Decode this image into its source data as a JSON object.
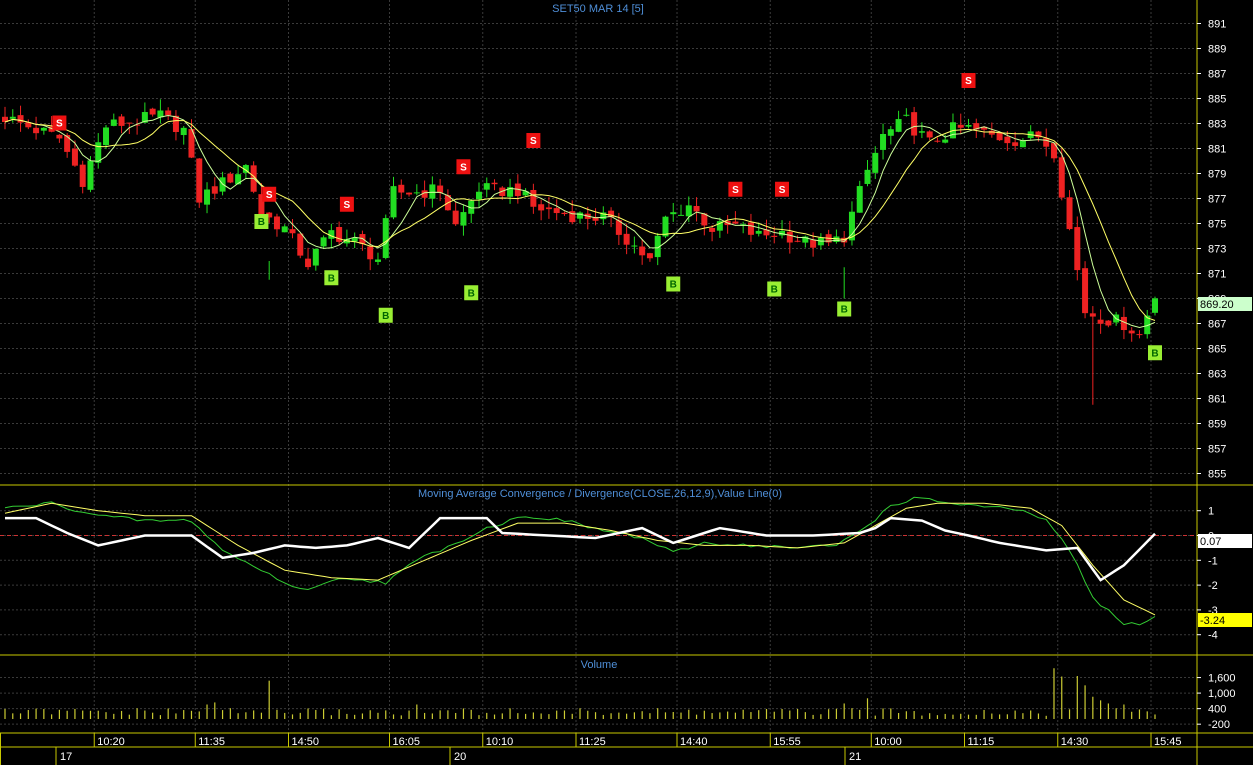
{
  "title": "SET50 MAR 14   [5]",
  "colors": {
    "background": "#000000",
    "grid": "#3a3a3a",
    "frame": "#c8c800",
    "up_candle": "#22dd22",
    "down_candle": "#ee2222",
    "ma_fast": "#ffff66",
    "ma_slow": "#ccff99",
    "macd": "#33cc33",
    "signal": "#ffff66",
    "value_line": "#ffffff",
    "zero_line": "#cc3333",
    "volume": "#cccc33",
    "title_text": "#4f8fd8",
    "buy_marker": "#99ee33",
    "sell_marker": "#ee1111",
    "axis_text": "#ffffff"
  },
  "price_panel": {
    "y_ticks": [
      "891",
      "889",
      "887",
      "885",
      "883",
      "881",
      "879",
      "877",
      "875",
      "873",
      "871",
      "869",
      "867",
      "865",
      "863",
      "861",
      "859",
      "857",
      "855"
    ],
    "ylim": [
      854,
      892
    ],
    "last_price": "869.20"
  },
  "macd_panel": {
    "title": "Moving Average Convergence / Divergence(CLOSE,26,12,9),Value Line(0)",
    "y_ticks": [
      "1",
      "0",
      "-1",
      "-2",
      "-3",
      "-4"
    ],
    "ylim": [
      -4.5,
      1.8
    ],
    "value_badge": "0.07",
    "macd_badge": "-3.24"
  },
  "volume_panel": {
    "title": "Volume",
    "y_ticks": [
      "1,600",
      "1,000",
      "400",
      "-200"
    ],
    "ylim": [
      -350,
      2050
    ]
  },
  "time_axis": {
    "times": [
      "10:20",
      "11:35",
      "14:50",
      "16:05",
      "10:10",
      "11:25",
      "14:40",
      "15:55",
      "10:00",
      "11:15",
      "14:30",
      "15:45"
    ],
    "days": [
      "17",
      "20",
      "21"
    ]
  },
  "signal_labels": {
    "buy": "B",
    "sell": "S"
  },
  "chart_data": {
    "type": "candlestick",
    "title": "SET50 MAR 14   [5]",
    "x_bars": 148,
    "time_ticks": [
      {
        "bar": 12,
        "label": "10:20"
      },
      {
        "bar": 25,
        "label": "11:35"
      },
      {
        "bar": 37,
        "label": "14:50"
      },
      {
        "bar": 50,
        "label": "16:05"
      },
      {
        "bar": 62,
        "label": "10:10"
      },
      {
        "bar": 74,
        "label": "11:25"
      },
      {
        "bar": 87,
        "label": "14:40"
      },
      {
        "bar": 99,
        "label": "15:55"
      },
      {
        "bar": 112,
        "label": "10:00"
      },
      {
        "bar": 124,
        "label": "11:15"
      },
      {
        "bar": 136,
        "label": "14:30"
      },
      {
        "bar": 148,
        "label": "15:45"
      }
    ],
    "day_ticks": [
      {
        "bar": 7,
        "label": "17"
      },
      {
        "bar": 58,
        "label": "20"
      },
      {
        "bar": 109,
        "label": "21"
      }
    ],
    "price_keypoints": [
      [
        0,
        883.5
      ],
      [
        4,
        882.5
      ],
      [
        7,
        881.8
      ],
      [
        10,
        878.5
      ],
      [
        13,
        882.8
      ],
      [
        17,
        883.2
      ],
      [
        20,
        883.6
      ],
      [
        23,
        882.5
      ],
      [
        25,
        877
      ],
      [
        28,
        878.2
      ],
      [
        31,
        879.6
      ],
      [
        33,
        875.8
      ],
      [
        36,
        874.6
      ],
      [
        39,
        871.8
      ],
      [
        42,
        874.3
      ],
      [
        45,
        873.5
      ],
      [
        48,
        872.2
      ],
      [
        50,
        877.5
      ],
      [
        53,
        877.5
      ],
      [
        56,
        877.7
      ],
      [
        58,
        874.8
      ],
      [
        61,
        877.8
      ],
      [
        63,
        877.6
      ],
      [
        66,
        877.7
      ],
      [
        68,
        876.3
      ],
      [
        71,
        875.9
      ],
      [
        74,
        875.6
      ],
      [
        77,
        875.5
      ],
      [
        80,
        873.8
      ],
      [
        83,
        872
      ],
      [
        85,
        875.4
      ],
      [
        88,
        876.5
      ],
      [
        91,
        874.6
      ],
      [
        94,
        874.8
      ],
      [
        97,
        874
      ],
      [
        100,
        874.3
      ],
      [
        103,
        873.5
      ],
      [
        106,
        873.3
      ],
      [
        108,
        874
      ],
      [
        111,
        879.2
      ],
      [
        113,
        882
      ],
      [
        116,
        883.2
      ],
      [
        119,
        881.4
      ],
      [
        122,
        882.5
      ],
      [
        124,
        882.6
      ],
      [
        127,
        882
      ],
      [
        130,
        881.7
      ],
      [
        133,
        882
      ],
      [
        135,
        880.8
      ],
      [
        137,
        874.5
      ],
      [
        139,
        868
      ],
      [
        141,
        867.5
      ],
      [
        144,
        867
      ],
      [
        146,
        866.1
      ],
      [
        148,
        869.2
      ]
    ],
    "sell_signals": [
      {
        "bar": 7,
        "price": 883
      },
      {
        "bar": 34,
        "price": 877.3
      },
      {
        "bar": 44,
        "price": 876.5
      },
      {
        "bar": 59,
        "price": 879.5
      },
      {
        "bar": 68,
        "price": 881.6
      },
      {
        "bar": 94,
        "price": 877.7
      },
      {
        "bar": 100,
        "price": 877.7
      },
      {
        "bar": 124,
        "price": 886.4
      }
    ],
    "buy_signals": [
      {
        "bar": 33,
        "price": 875.2
      },
      {
        "bar": 42,
        "price": 870.7
      },
      {
        "bar": 49,
        "price": 867.7
      },
      {
        "bar": 60,
        "price": 869.5
      },
      {
        "bar": 86,
        "price": 870.2
      },
      {
        "bar": 99,
        "price": 869.8
      },
      {
        "bar": 108,
        "price": 868.2
      },
      {
        "bar": 148,
        "price": 864.7
      }
    ],
    "macd_keypoints": [
      [
        0,
        1.1
      ],
      [
        6,
        1.3
      ],
      [
        12,
        0.8
      ],
      [
        18,
        0.6
      ],
      [
        24,
        0.6
      ],
      [
        28,
        -0.6
      ],
      [
        33,
        -1.4
      ],
      [
        38,
        -2.2
      ],
      [
        44,
        -1.7
      ],
      [
        49,
        -1.9
      ],
      [
        53,
        -1
      ],
      [
        58,
        -0.3
      ],
      [
        62,
        0.3
      ],
      [
        67,
        0.8
      ],
      [
        72,
        0.6
      ],
      [
        77,
        0.2
      ],
      [
        82,
        -0.1
      ],
      [
        86,
        -0.7
      ],
      [
        90,
        -0.3
      ],
      [
        96,
        -0.4
      ],
      [
        102,
        -0.5
      ],
      [
        107,
        -0.4
      ],
      [
        111,
        0.4
      ],
      [
        114,
        1.2
      ],
      [
        117,
        1.5
      ],
      [
        122,
        1.3
      ],
      [
        128,
        1.1
      ],
      [
        132,
        0.9
      ],
      [
        134,
        0.6
      ],
      [
        137,
        -0.6
      ],
      [
        140,
        -2.5
      ],
      [
        144,
        -3.6
      ],
      [
        147,
        -3.5
      ],
      [
        148,
        -3.24
      ]
    ],
    "signal_keypoints": [
      [
        0,
        0.9
      ],
      [
        6,
        1.3
      ],
      [
        12,
        1
      ],
      [
        18,
        0.8
      ],
      [
        24,
        0.8
      ],
      [
        30,
        -0.4
      ],
      [
        36,
        -1.4
      ],
      [
        42,
        -1.7
      ],
      [
        48,
        -1.8
      ],
      [
        54,
        -1
      ],
      [
        60,
        -0.2
      ],
      [
        66,
        0.5
      ],
      [
        72,
        0.5
      ],
      [
        78,
        0.2
      ],
      [
        84,
        -0.2
      ],
      [
        90,
        -0.4
      ],
      [
        96,
        -0.4
      ],
      [
        102,
        -0.5
      ],
      [
        108,
        -0.3
      ],
      [
        112,
        0.4
      ],
      [
        116,
        1.1
      ],
      [
        120,
        1.3
      ],
      [
        126,
        1.3
      ],
      [
        132,
        1.1
      ],
      [
        136,
        0.4
      ],
      [
        140,
        -1.2
      ],
      [
        144,
        -2.6
      ],
      [
        148,
        -3.2
      ]
    ],
    "value_keypoints": [
      [
        0,
        0.7
      ],
      [
        4,
        0.7
      ],
      [
        8,
        0.1
      ],
      [
        12,
        -0.4
      ],
      [
        18,
        0
      ],
      [
        24,
        0
      ],
      [
        28,
        -0.9
      ],
      [
        32,
        -0.7
      ],
      [
        36,
        -0.4
      ],
      [
        40,
        -0.5
      ],
      [
        44,
        -0.4
      ],
      [
        48,
        -0.1
      ],
      [
        52,
        -0.5
      ],
      [
        56,
        0.7
      ],
      [
        62,
        0.7
      ],
      [
        64,
        0.1
      ],
      [
        70,
        0
      ],
      [
        76,
        -0.1
      ],
      [
        82,
        0.3
      ],
      [
        86,
        -0.3
      ],
      [
        92,
        0.3
      ],
      [
        98,
        0
      ],
      [
        104,
        0
      ],
      [
        110,
        0.1
      ],
      [
        112,
        0.3
      ],
      [
        114,
        0.7
      ],
      [
        118,
        0.6
      ],
      [
        121,
        0.2
      ],
      [
        124,
        0
      ],
      [
        128,
        -0.3
      ],
      [
        134,
        -0.6
      ],
      [
        138,
        -0.5
      ],
      [
        141,
        -1.8
      ],
      [
        144,
        -1.2
      ],
      [
        148,
        0.07
      ]
    ],
    "volume_spikes": [
      [
        26,
        560
      ],
      [
        27,
        640
      ],
      [
        34,
        1480
      ],
      [
        53,
        560
      ],
      [
        108,
        600
      ],
      [
        111,
        800
      ],
      [
        135,
        1960
      ],
      [
        136,
        1640
      ],
      [
        138,
        1660
      ],
      [
        139,
        1300
      ],
      [
        140,
        860
      ],
      [
        141,
        720
      ],
      [
        142,
        600
      ],
      [
        144,
        560
      ]
    ]
  }
}
